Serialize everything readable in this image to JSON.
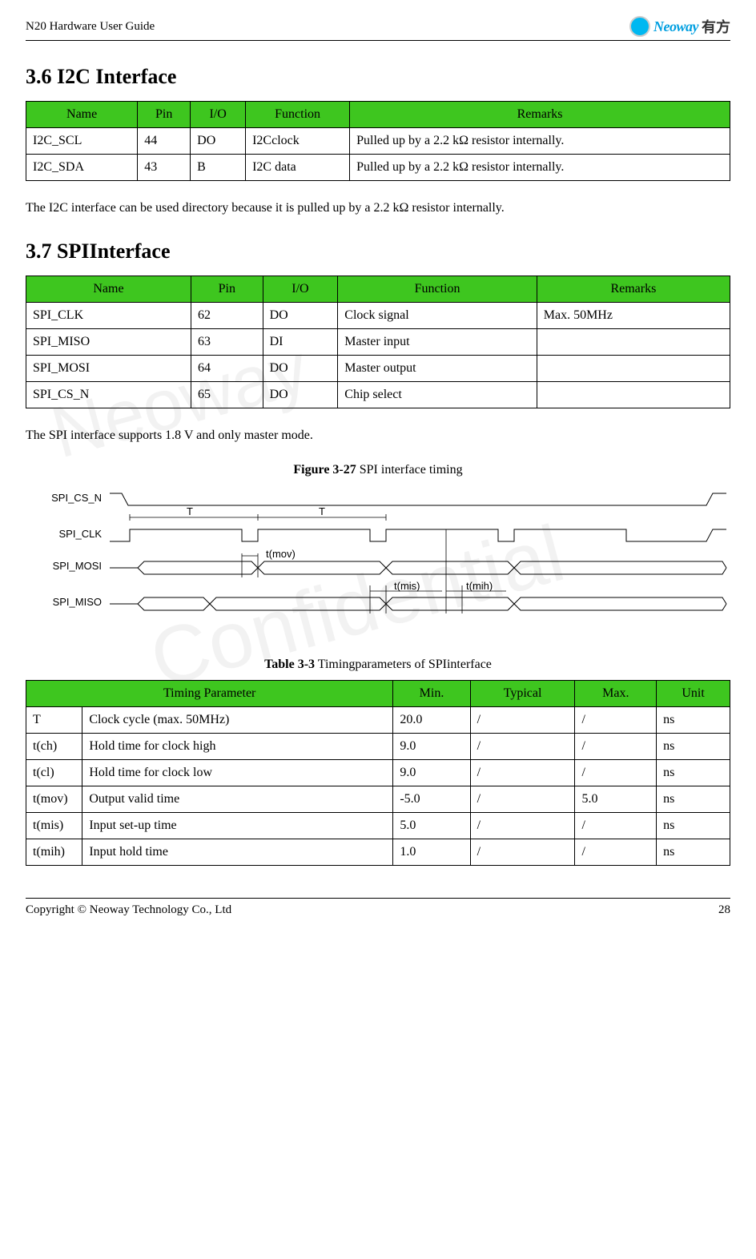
{
  "header": {
    "doc_title": "N20 Hardware User Guide",
    "logo_text": "Neoway",
    "logo_cn": "有方"
  },
  "section1": {
    "heading": "3.6  I2C Interface",
    "table": {
      "headers": [
        "Name",
        "Pin",
        "I/O",
        "Function",
        "Remarks"
      ],
      "rows": [
        [
          "I2C_SCL",
          "44",
          "DO",
          "I2Cclock",
          "Pulled up by a 2.2 kΩ resistor internally."
        ],
        [
          "I2C_SDA",
          "43",
          "B",
          "I2C data",
          "Pulled up by a 2.2 kΩ resistor internally."
        ]
      ]
    },
    "body": "The I2C interface can be used directory because it is pulled up by a 2.2 kΩ resistor internally."
  },
  "section2": {
    "heading": "3.7  SPIInterface",
    "table": {
      "headers": [
        "Name",
        "Pin",
        "I/O",
        "Function",
        "Remarks"
      ],
      "rows": [
        [
          "SPI_CLK",
          "62",
          "DO",
          "Clock signal",
          "Max. 50MHz"
        ],
        [
          "SPI_MISO",
          "63",
          "DI",
          "Master input",
          ""
        ],
        [
          "SPI_MOSI",
          "64",
          "DO",
          "Master output",
          ""
        ],
        [
          "SPI_CS_N",
          "65",
          "DO",
          "Chip select",
          ""
        ]
      ]
    },
    "body": "The SPI interface supports 1.8 V and only master mode.",
    "figure_label": "Figure 3-27",
    "figure_title": " SPI interface timing",
    "diagram": {
      "signals": [
        "SPI_CS_N",
        "SPI_CLK",
        "SPI_MOSI",
        "SPI_MISO"
      ],
      "labels": {
        "T1": "T",
        "T2": "T",
        "tmov": "t(mov)",
        "tmis": "t(mis)",
        "tmih": "t(mih)"
      }
    },
    "table3_label": "Table 3-3",
    "table3_title": " Timingparameters of SPIinterface",
    "table3": {
      "headers": [
        "Timing Parameter",
        "Min.",
        "Typical",
        "Max.",
        "Unit"
      ],
      "rows": [
        [
          "T",
          "Clock cycle (max. 50MHz)",
          "20.0",
          "/",
          "/",
          "ns"
        ],
        [
          "t(ch)",
          "Hold time for clock high",
          "9.0",
          "/",
          "/",
          "ns"
        ],
        [
          "t(cl)",
          "Hold time for clock low",
          "9.0",
          "/",
          "/",
          "ns"
        ],
        [
          "t(mov)",
          "Output valid time",
          "-5.0",
          "/",
          "5.0",
          "ns"
        ],
        [
          "t(mis)",
          "Input set-up time",
          "5.0",
          "/",
          "/",
          "ns"
        ],
        [
          "t(mih)",
          "Input hold time",
          "1.0",
          "/",
          "/",
          "ns"
        ]
      ]
    }
  },
  "footer": {
    "copyright": "Copyright © Neoway Technology Co., Ltd",
    "page": "28"
  },
  "watermarks": [
    "Neoway",
    "Confidential"
  ]
}
